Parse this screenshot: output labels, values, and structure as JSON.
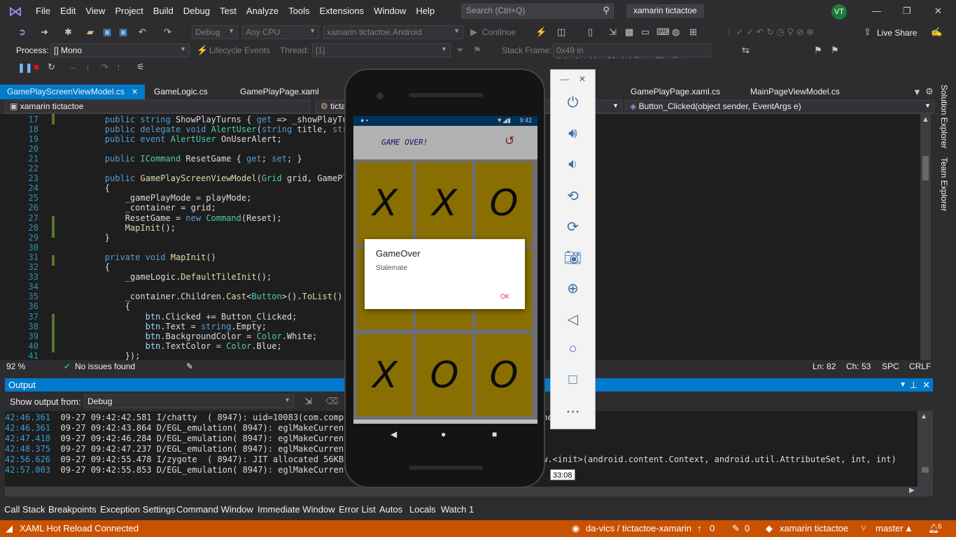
{
  "menu": {
    "items": [
      "File",
      "Edit",
      "View",
      "Project",
      "Build",
      "Debug",
      "Test",
      "Analyze",
      "Tools",
      "Extensions",
      "Window",
      "Help"
    ],
    "search_placeholder": "Search (Ctrl+Q)",
    "solution_name": "xamarin tictactoe",
    "user_initials": "VT",
    "live_share": "Live Share"
  },
  "toolbar": {
    "config": "Debug",
    "platform": "Any CPU",
    "startup_project": "xamarin tictactoe.Android",
    "continue": "Continue",
    "process_label": "Process:",
    "process_value": "[] Mono",
    "lifecycle": "Lifecycle Events",
    "thread_label": "Thread:",
    "thread_value": "[1]",
    "stack_frame_label": "Stack Frame:",
    "stack_frame_value": "0x49 in tictactoe.ViewModel.GamePlayScr"
  },
  "tabs": [
    {
      "label": "GamePlayScreenViewModel.cs",
      "active": true
    },
    {
      "label": "GameLogic.cs"
    },
    {
      "label": "GamePlayPage.xaml"
    },
    {
      "label": "GamePlayPage.xaml.cs"
    },
    {
      "label": "MainPageViewModel.cs"
    }
  ],
  "navbar": {
    "project": "xamarin tictactoe",
    "type_partial": "ticta",
    "member": "Button_Clicked(object sender, EventArgs e)"
  },
  "code_lines": [
    {
      "n": "17",
      "html": "        <span class='kw'>public</span> <span class='kw'>string</span> ShowPlayTurns { <span class='kw'>get</span> => _showPlayTurns;"
    },
    {
      "n": "18",
      "html": "        <span class='kw'>public</span> <span class='kw'>delegate</span> <span class='kw'>void</span> <span class='ty'>AlertUser</span>(<span class='kw'>string</span> title, <span class='kw'>string</span> m"
    },
    {
      "n": "19",
      "html": "        <span class='kw'>public</span> <span class='kw'>event</span> <span class='ty'>AlertUser</span> OnUserAlert;"
    },
    {
      "n": "20",
      "html": ""
    },
    {
      "n": "21",
      "html": "        <span class='kw'>public</span> <span class='ty'>ICommand</span> ResetGame { <span class='kw'>get</span>; <span class='kw'>set</span>; }"
    },
    {
      "n": "22",
      "html": ""
    },
    {
      "n": "23",
      "html": "        <span class='kw'>public</span> <span class='fn'>GamePlayScreenViewModel</span>(<span class='ty'>Grid</span> grid, GamePlayMod"
    },
    {
      "n": "24",
      "html": "        {"
    },
    {
      "n": "25",
      "html": "            _gamePlayMode = playMode;"
    },
    {
      "n": "26",
      "html": "            _container = grid;"
    },
    {
      "n": "27",
      "html": "            ResetGame = <span class='kw'>new</span> <span class='ty'>Command</span>(Reset);"
    },
    {
      "n": "28",
      "html": "            <span class='fn'>MapInit</span>();"
    },
    {
      "n": "29",
      "html": "        }"
    },
    {
      "n": "30",
      "html": ""
    },
    {
      "n": "31",
      "html": "        <span class='kw'>private</span> <span class='kw'>void</span> <span class='fn'>MapInit</span>()"
    },
    {
      "n": "32",
      "html": "        {"
    },
    {
      "n": "33",
      "html": "            _gameLogic.<span class='fn'>DefaultTileInit</span>();"
    },
    {
      "n": "34",
      "html": ""
    },
    {
      "n": "35",
      "html": "            _container.Children.<span class='fn'>Cast</span>&lt;<span class='ty'>Button</span>&gt;().<span class='fn'>ToList</span>().<span class='fn'>ForEa</span>"
    },
    {
      "n": "36",
      "html": "            {"
    },
    {
      "n": "37",
      "html": "                <span class='var'>btn</span>.Clicked += Button_Clicked;"
    },
    {
      "n": "38",
      "html": "                <span class='var'>btn</span>.Text = <span class='kw'>string</span>.Empty;"
    },
    {
      "n": "39",
      "html": "                <span class='var'>btn</span>.BackgroundColor = <span class='ty'>Color</span>.White;"
    },
    {
      "n": "40",
      "html": "                <span class='var'>btn</span>.TextColor = <span class='ty'>Color</span>.Blue;"
    },
    {
      "n": "41",
      "html": "            });"
    }
  ],
  "editor_status": {
    "zoom": "92 %",
    "issues": "No issues found",
    "line": "Ln: 82",
    "col": "Ch: 53",
    "spc": "SPC",
    "eol": "CRLF"
  },
  "side_tabs": [
    "Solution Explorer",
    "Team Explorer"
  ],
  "output": {
    "title": "Output",
    "show_from_label": "Show output from:",
    "show_from_value": "Debug",
    "lines": [
      {
        "ts": "42:46.361",
        "text": "09-27 09:42:42.581 I/chatty  ( 8947): uid=10083(com.company",
        "tail": "nes"
      },
      {
        "ts": "42:46.361",
        "text": "09-27 09:42:43.864 D/EGL_emulation( 8947): eglMakeCurrent:",
        "tail": ""
      },
      {
        "ts": "42:47.418",
        "text": "09-27 09:42:46.284 D/EGL_emulation( 8947): eglMakeCurrent:",
        "tail": ""
      },
      {
        "ts": "42:48.375",
        "text": "09-27 09:42:47.237 D/EGL_emulation( 8947): eglMakeCurrent:",
        "tail": ""
      },
      {
        "ts": "42:56.626",
        "text": "09-27 09:42:55.478 I/zygote  ( 8947): JIT allocated 56KB fo",
        "tail": "w.<init>(android.content.Context, android.util.AttributeSet, int, int)"
      },
      {
        "ts": "42:57.003",
        "text": "09-27 09:42:55.853 D/EGL_emulation( 8947): eglMakeCurrent:",
        "tail": ""
      }
    ]
  },
  "bottom_tabs": [
    "Call Stack",
    "Breakpoints",
    "Exception Settings",
    "Command Window",
    "Immediate Window",
    "Error List",
    "Autos",
    "Locals",
    "Watch 1"
  ],
  "statusbar": {
    "hot_reload": "XAML Hot Reload Connected",
    "repo": "da-vics / tictactoe-xamarin",
    "up_count": "0",
    "edits_count": "0",
    "project": "xamarin tictactoe",
    "branch": "master",
    "notifications": "6"
  },
  "phone": {
    "time": "9:42",
    "app_title": "GAME OVER!",
    "board": [
      "X",
      "X",
      "O",
      "",
      "",
      "",
      "X",
      "O",
      "O"
    ],
    "dialog_title": "GameOver",
    "dialog_message": "Stalemate",
    "dialog_button": "OK"
  },
  "emulator": {
    "tooltip": "33:08"
  },
  "colors": {
    "accent": "#007acc",
    "statusbar": "#ca5100",
    "tile": "#b79402"
  }
}
